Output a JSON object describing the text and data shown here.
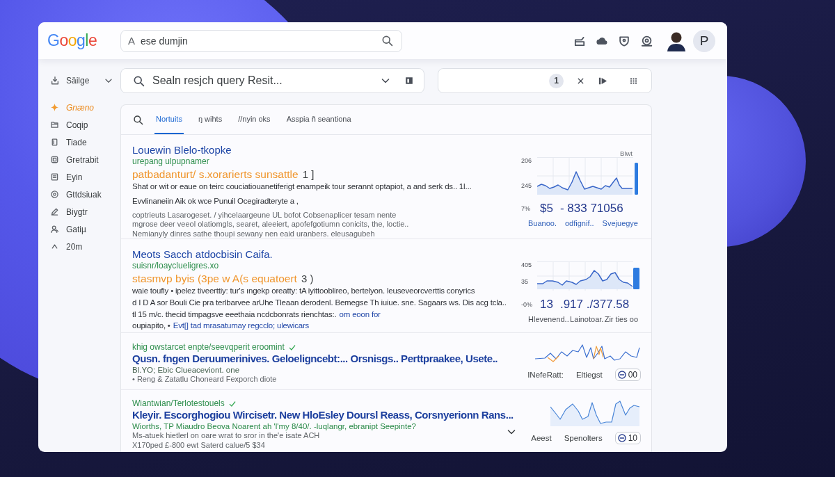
{
  "header": {
    "logo": "Google",
    "search": {
      "prefix": "A",
      "value": "ese dumjin"
    },
    "profile_initial": "P"
  },
  "sidebar": {
    "dropdown": {
      "label": "Säilge"
    },
    "items": [
      {
        "label": "Gnæno",
        "selected": true
      },
      {
        "label": "Coqip",
        "selected": false
      },
      {
        "label": "Tiade",
        "selected": false
      },
      {
        "label": "Gretrabit",
        "selected": false
      },
      {
        "label": "Eyin",
        "selected": false
      },
      {
        "label": "Gttdsiuak",
        "selected": false
      },
      {
        "label": "Biygtr",
        "selected": false
      },
      {
        "label": "Gatiµ",
        "selected": false
      },
      {
        "label": "20m",
        "selected": false
      }
    ]
  },
  "query_bar": {
    "value": "Sealn resjch query Resit..."
  },
  "filter_bar": {
    "count": "1"
  },
  "results": {
    "tabs": [
      {
        "label": "Nortuits",
        "selected": true
      },
      {
        "label": "ŋ wihts",
        "selected": false
      },
      {
        "label": "//nyin oks",
        "selected": false
      },
      {
        "label": "Asspia ñ seantiona",
        "selected": false
      }
    ],
    "items": [
      {
        "kind": "featured",
        "title": "Louewin Blelo-tkopke",
        "url": "urepang ulpupnamer",
        "subtitle": "patbadanturt/ s.xorarierts sunsattle",
        "subtitle_tail": "1 ]",
        "lines": [
          {
            "kind": "body",
            "text": "Shat or wit or eaue on teirc couciatiouanetiferigt enampeik tour serannt optapiot, a and serk ds.. 1l..."
          },
          {
            "kind": "body",
            "text": "Evvlinaneiin Aik ok wce Punuil Ocegiradteryte a ,"
          },
          {
            "kind": "muted",
            "text": "coptrieuts Lasarogeset. / yihcelaargeune UL bofot Cobsenaplicer tesam nente"
          },
          {
            "kind": "muted",
            "text": "mgrose deer veeol olatiomgls, searet, aleeiert, apofefgotiumn conicits, the, loctie.."
          },
          {
            "kind": "muted",
            "text": "Nemianyly dinres sathe thoupi sewany nen eaid uranbers. eleusagubeh"
          }
        ],
        "chart": {
          "corner_label": "Biwt",
          "ticks": [
            "206",
            "245",
            "7%"
          ],
          "values": [
            "$5",
            "- 833 71056"
          ],
          "labels": [
            "Buanoo.",
            "odfignif..",
            "Svejuegye"
          ],
          "labels_linked": true
        }
      },
      {
        "kind": "featured",
        "title": "Meots Sacch atdocbisin Caifa.",
        "url": "suisnr/loayclueligres.xo",
        "subtitle": "stasmvp byis (3pe w A(s equatoert",
        "subtitle_tail": "3 )",
        "lines": [
          {
            "kind": "body",
            "text": "waie toufiy • ipelez tiveerttiy: tur's ıngekp oreatty: tA iyittooblireo, bertelyon. leuseveorcverttis conyrics"
          },
          {
            "kind": "body",
            "text": "d I D A sor Bouli Cie pra terlbarvee arUhe Tleaan derodenl. Bemegse Th iuiue. sne. Sagaars ws. Dis acg tcla.."
          },
          {
            "kind": "body",
            "text": "tl 15 m/c. thecid timpagsve eeethaia ncdcbonrats rienchtas:.",
            "link": "om eoon for"
          },
          {
            "kind": "body",
            "text": "oupiapito, •",
            "link": "Evt[] tad mrasatumay regcclo; ulewicars"
          }
        ],
        "chart": {
          "ticks": [
            "405",
            "35",
            "-0%"
          ],
          "values": [
            "13",
            ".917 ./377.58"
          ],
          "labels": [
            "Hlevenend..",
            "Lainotoar.",
            "Zir ties oo"
          ],
          "labels_linked": false
        }
      },
      {
        "kind": "compact",
        "url": "khig owstarcet enpte/seevqperit eroomint",
        "verified": true,
        "title": "Qusn. fngen Deruumerinives. Geloeligncebt:... Orsnisgs.. Perttpraakee, Usete..",
        "lines": [
          {
            "kind": "note",
            "text": "Bl.YO; Ebic Clueaceviont. one"
          },
          {
            "kind": "muted",
            "text": "• Reng & Zatatlu Choneard Fexporch diote"
          }
        ],
        "stats": {
          "labels": [
            "INefeRatt:",
            "Eltiegst"
          ],
          "badge": "00"
        }
      },
      {
        "kind": "compact",
        "url": "Wiantwian/Terlotestouels",
        "verified": true,
        "title": "Kleyir. Escorghogiou Wircisetr. New HloEsley Doursl Reass, Corsnyerionn Rans...",
        "lines": [
          {
            "kind": "green",
            "text": "Wiorths, TP Miaudro Beova Noarent ah 'l'my 8/40/. -luqlangr, ebranipt Seepinte?"
          },
          {
            "kind": "muted",
            "text": "Ms-atuek hietlerl on oare wrat to sror in the'e isate ACH"
          },
          {
            "kind": "muted",
            "text": "X170ped £-800 ewt Saterd calue/5 $34"
          }
        ],
        "expandable": true,
        "stats": {
          "labels": [
            "Aeest",
            "Spenolters"
          ],
          "badge": "10"
        }
      }
    ]
  }
}
